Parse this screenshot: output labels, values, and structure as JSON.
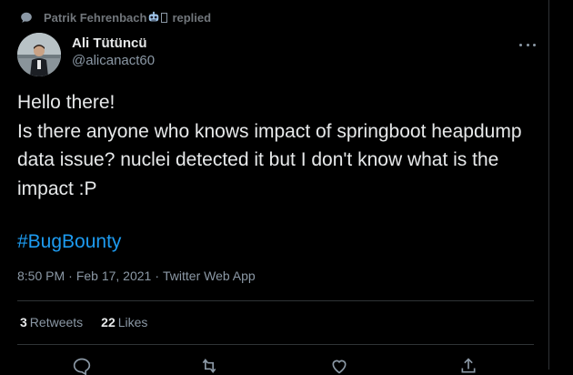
{
  "context": {
    "name": "Patrik Fehrenbach",
    "action": "replied"
  },
  "author": {
    "display_name": "Ali Tütüncü",
    "handle": "@alicanact60"
  },
  "tweet": {
    "text": "Hello there!\nIs there anyone who knows impact of springboot heapdump data issue? nuclei detected it but I don't know what is the impact :P",
    "hashtag": "#BugBounty"
  },
  "meta": {
    "time": "8:50 PM",
    "sep1": "·",
    "date": "Feb 17, 2021",
    "sep2": "·",
    "source": "Twitter Web App"
  },
  "stats": {
    "retweets_count": "3",
    "retweets_label": "Retweets",
    "likes_count": "22",
    "likes_label": "Likes"
  },
  "icons": {
    "context": "speech-bubble-icon",
    "emoji": "robot-face-icon",
    "more": "more-horizontal-icon",
    "reply": "reply-icon",
    "retweet": "retweet-icon",
    "like": "heart-icon",
    "share": "share-icon"
  },
  "colors": {
    "background": "#000000",
    "text": "#e7e9ea",
    "muted": "#8b98a5",
    "link": "#1d9bf0",
    "border": "#2f3336"
  }
}
